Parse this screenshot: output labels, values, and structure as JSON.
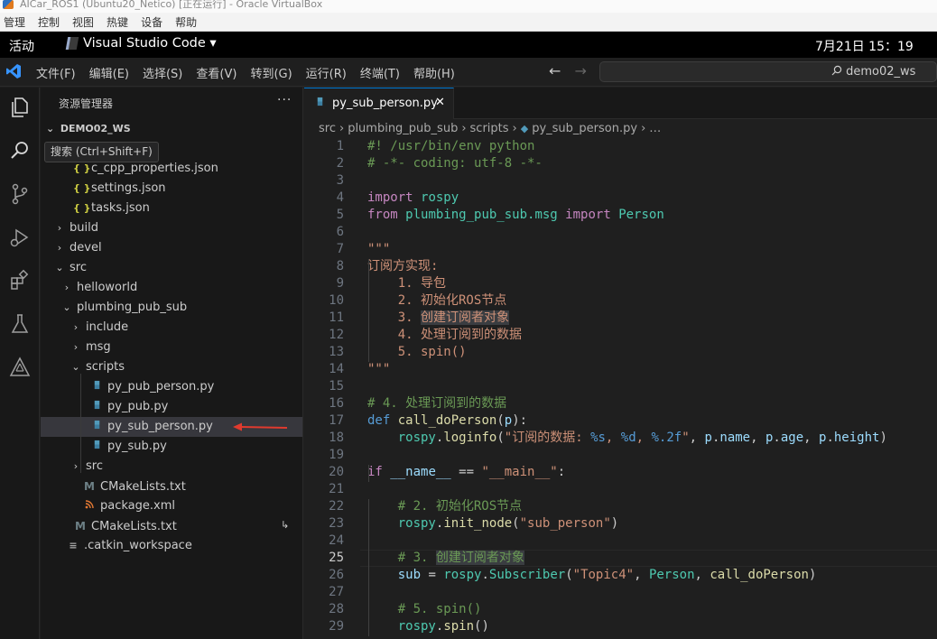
{
  "vbox": {
    "title": "AICar_ROS1 (Ubuntu20_Netico) [正在运行] - Oracle VirtualBox",
    "menu": [
      "管理",
      "控制",
      "视图",
      "热键",
      "设备",
      "帮助"
    ]
  },
  "gnome": {
    "activities": "活动",
    "app": "Visual Studio Code ▾",
    "clock": "7月21日  15：19"
  },
  "vscode": {
    "menus": [
      "文件(F)",
      "编辑(E)",
      "选择(S)",
      "查看(V)",
      "转到(G)",
      "运行(R)",
      "终端(T)",
      "帮助(H)"
    ],
    "search_box": "demo02_ws"
  },
  "tooltip": "搜索 (Ctrl+Shift+F)",
  "sidebar": {
    "title": "资源管理器",
    "more": "···",
    "workspace": "DEMO02_WS",
    "tree": [
      {
        "label": "c_cpp_properties.json",
        "icon": "json-icon",
        "glyph": "{ }",
        "depth": 2,
        "chev": ""
      },
      {
        "label": "settings.json",
        "icon": "json-icon",
        "glyph": "{ }",
        "depth": 2,
        "chev": ""
      },
      {
        "label": "tasks.json",
        "icon": "json-icon",
        "glyph": "{ }",
        "depth": 2,
        "chev": ""
      },
      {
        "label": "build",
        "icon": "",
        "glyph": "",
        "depth": 1,
        "chev": "›"
      },
      {
        "label": "devel",
        "icon": "",
        "glyph": "",
        "depth": 1,
        "chev": "›"
      },
      {
        "label": "src",
        "icon": "",
        "glyph": "",
        "depth": 1,
        "chev": "⌄"
      },
      {
        "label": "helloworld",
        "icon": "",
        "glyph": "",
        "depth": 2,
        "chev": "›"
      },
      {
        "label": "plumbing_pub_sub",
        "icon": "",
        "glyph": "",
        "depth": 2,
        "chev": "⌄"
      },
      {
        "label": "include",
        "icon": "",
        "glyph": "",
        "depth": 3,
        "chev": "›"
      },
      {
        "label": "msg",
        "icon": "",
        "glyph": "",
        "depth": 3,
        "chev": "›"
      },
      {
        "label": "scripts",
        "icon": "",
        "glyph": "",
        "depth": 3,
        "chev": "⌄"
      },
      {
        "label": "py_pub_person.py",
        "icon": "python-file-icon",
        "glyph": "",
        "depth": 4,
        "chev": ""
      },
      {
        "label": "py_pub.py",
        "icon": "python-file-icon",
        "glyph": "",
        "depth": 4,
        "chev": ""
      },
      {
        "label": "py_sub_person.py",
        "icon": "python-file-icon",
        "glyph": "",
        "depth": 4,
        "chev": "",
        "selected": true
      },
      {
        "label": "py_sub.py",
        "icon": "python-file-icon",
        "glyph": "",
        "depth": 4,
        "chev": ""
      },
      {
        "label": "src",
        "icon": "",
        "glyph": "",
        "depth": 3,
        "chev": "›"
      },
      {
        "label": "CMakeLists.txt",
        "icon": "cmake-icon",
        "glyph": "M",
        "depth": 3,
        "chev": ""
      },
      {
        "label": "package.xml",
        "icon": "xml-rss-icon",
        "glyph": "",
        "depth": 3,
        "chev": ""
      },
      {
        "label": "CMakeLists.txt",
        "icon": "cmake-icon",
        "glyph": "M",
        "depth": 2,
        "chev": ""
      },
      {
        "label": ".catkin_workspace",
        "icon": "text-file-icon",
        "glyph": "≡",
        "depth": 1,
        "chev": ""
      }
    ]
  },
  "editor": {
    "tab": {
      "label": "py_sub_person.py",
      "close": "✕"
    },
    "breadcrumb": [
      "src",
      "plumbing_pub_sub",
      "scripts",
      "py_sub_person.py",
      "…"
    ],
    "active_line": 25,
    "lines": [
      {
        "n": "1",
        "html": "<span class=\"cm\">#! /usr/bin/env python</span>"
      },
      {
        "n": "2",
        "html": "<span class=\"cm\"># -*- coding: utf-8 -*-</span>"
      },
      {
        "n": "3",
        "html": ""
      },
      {
        "n": "4",
        "html": "<span class=\"kw\">import</span> <span class=\"mod\">rospy</span>"
      },
      {
        "n": "5",
        "html": "<span class=\"kw\">from</span> <span class=\"mod\">plumbing_pub_sub.msg</span> <span class=\"kw\">import</span> <span class=\"cls\">Person</span>"
      },
      {
        "n": "6",
        "html": ""
      },
      {
        "n": "7",
        "html": "<span class=\"st\">\"\"\"</span>"
      },
      {
        "n": "8",
        "html": "<span class=\"st\">订阅方实现:</span>"
      },
      {
        "n": "9",
        "html": "<span class=\"st\">    1. 导包</span>"
      },
      {
        "n": "10",
        "html": "<span class=\"st\">    2. 初始化ROS节点</span>"
      },
      {
        "n": "11",
        "html": "<span class=\"st\">    3. <span class=\"hl\">创建订阅者对象</span></span>"
      },
      {
        "n": "12",
        "html": "<span class=\"st\">    4. 处理订阅到的数据</span>"
      },
      {
        "n": "13",
        "html": "<span class=\"st\">    5. spin()</span>"
      },
      {
        "n": "14",
        "html": "<span class=\"st\">\"\"\"</span>"
      },
      {
        "n": "15",
        "html": ""
      },
      {
        "n": "16",
        "html": "<span class=\"cm\"># 4. 处理订阅到的数据</span>"
      },
      {
        "n": "17",
        "html": "<span class=\"kw2\">def</span> <span class=\"fn\">call_doPerson</span>(<span class=\"var\">p</span>):"
      },
      {
        "n": "18",
        "html": "    <span class=\"mod\">rospy</span>.<span class=\"fn\">loginfo</span>(<span class=\"st\">\"订阅的数据: </span><span class=\"fmt\">%s</span><span class=\"st\">, </span><span class=\"fmt\">%d</span><span class=\"st\">, </span><span class=\"fmt\">%.2f</span><span class=\"st\">\"</span>, <span class=\"var\">p</span>.<span class=\"var\">name</span>, <span class=\"var\">p</span>.<span class=\"var\">age</span>, <span class=\"var\">p</span>.<span class=\"var\">height</span>)"
      },
      {
        "n": "19",
        "html": ""
      },
      {
        "n": "20",
        "html": "<span class=\"kw\">if</span> <span class=\"var\">__name__</span> == <span class=\"st\">\"__main__\"</span>:"
      },
      {
        "n": "21",
        "html": ""
      },
      {
        "n": "22",
        "html": "    <span class=\"cm\"># 2. 初始化ROS节点</span>"
      },
      {
        "n": "23",
        "html": "    <span class=\"mod\">rospy</span>.<span class=\"fn\">init_node</span>(<span class=\"st\">\"sub_person\"</span>)"
      },
      {
        "n": "24",
        "html": ""
      },
      {
        "n": "25",
        "html": "    <span class=\"cm\"># 3. <span class=\"hl\">创建订阅者对象</span></span>"
      },
      {
        "n": "26",
        "html": "    <span class=\"var\">sub</span> = <span class=\"mod\">rospy</span>.<span class=\"cls\">Subscriber</span>(<span class=\"st\">\"Topic4\"</span>, <span class=\"cls\">Person</span>, <span class=\"fn\">call_doPerson</span>)"
      },
      {
        "n": "27",
        "html": ""
      },
      {
        "n": "28",
        "html": "    <span class=\"cm\"># 5. spin()</span>"
      },
      {
        "n": "29",
        "html": "    <span class=\"mod\">rospy</span>.<span class=\"fn\">spin</span>()"
      }
    ]
  }
}
